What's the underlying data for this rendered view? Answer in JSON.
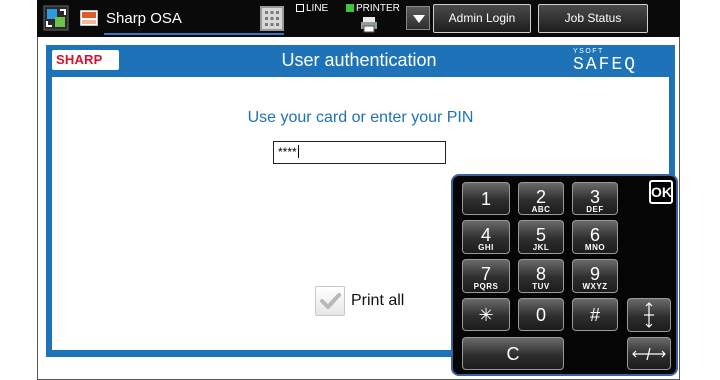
{
  "topbar": {
    "app_title": "Sharp OSA",
    "osa_icon_text": "OSA",
    "line_label": "LINE",
    "printer_label": "PRINTER",
    "admin_login_label": "Admin Login",
    "job_status_label": "Job Status"
  },
  "header": {
    "sharp_logo": "SHARP",
    "title": "User authentication",
    "safeq_small": "YSOFT",
    "safeq_main": "SAFEQ"
  },
  "main": {
    "instruction": "Use your card or enter your PIN",
    "pin_value": "****",
    "print_all_label": "Print all",
    "print_all_checked": true
  },
  "keypad": {
    "ok_label": "OK",
    "keys": [
      {
        "digit": "1",
        "letters": ""
      },
      {
        "digit": "2",
        "letters": "ABC"
      },
      {
        "digit": "3",
        "letters": "DEF"
      },
      {
        "digit": "4",
        "letters": "GHI"
      },
      {
        "digit": "5",
        "letters": "JKL"
      },
      {
        "digit": "6",
        "letters": "MNO"
      },
      {
        "digit": "7",
        "letters": "PQRS"
      },
      {
        "digit": "8",
        "letters": "TUV"
      },
      {
        "digit": "9",
        "letters": "WXYZ"
      },
      {
        "digit": "✳",
        "letters": ""
      },
      {
        "digit": "0",
        "letters": ""
      },
      {
        "digit": "#",
        "letters": ""
      }
    ],
    "clear_label": "C",
    "accent_color": "#3e5fa0"
  },
  "colors": {
    "frame_blue": "#1e73b8",
    "brand_red": "#d4122d",
    "check_green": "#3ec43e"
  }
}
